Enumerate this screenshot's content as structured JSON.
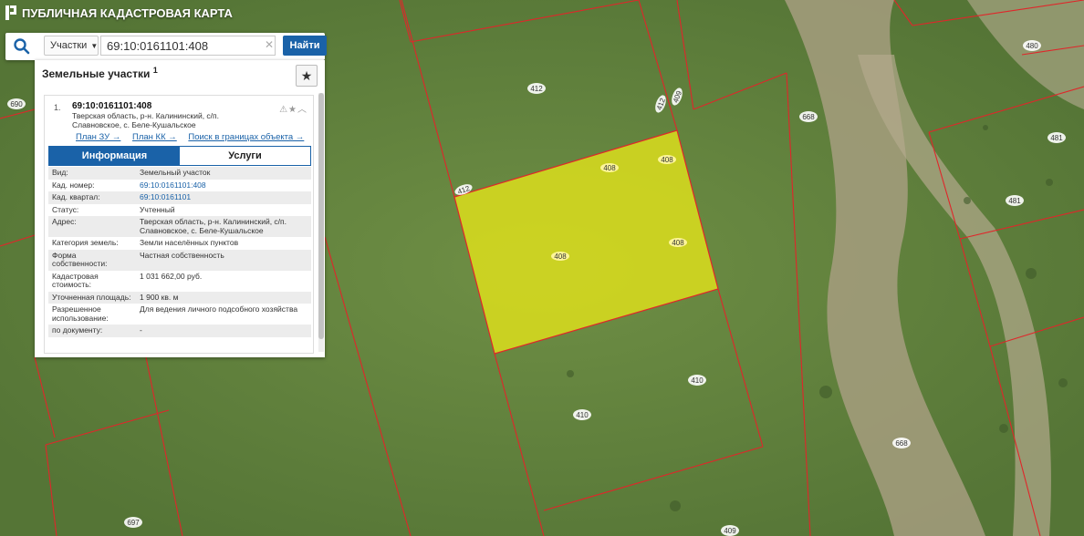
{
  "app": {
    "title": "ПУБЛИЧНАЯ КАДАСТРОВАЯ КАРТА"
  },
  "search": {
    "type_label": "Участки",
    "value": "69:10:0161101:408",
    "button_label": "Найти"
  },
  "panel": {
    "title": "Земельные участки",
    "count": "1",
    "item": {
      "number": "1.",
      "cadastral": "69:10:0161101:408",
      "address_line1": "Тверская область, р-н. Калининский, с/п.",
      "address_line2": "Славновское, с. Беле-Кушальское",
      "links": [
        "План ЗУ →",
        "План КК →",
        "Поиск в границах объекта →"
      ],
      "tabs": [
        "Информация",
        "Услуги"
      ]
    },
    "info": [
      {
        "key": "Вид:",
        "value": "Земельный участок"
      },
      {
        "key": "Кад. номер:",
        "value": "69:10:0161101:408"
      },
      {
        "key": "Кад. квартал:",
        "value": "69:10:0161101"
      },
      {
        "key": "Статус:",
        "value": "Учтенный"
      },
      {
        "key": "Адрес:",
        "value": "Тверская область, р-н. Калининский, с/п. Славновское, с. Беле-Кушальское"
      },
      {
        "key": "Категория земель:",
        "value": "Земли населённых пунктов"
      },
      {
        "key": "Форма собственности:",
        "value": "Частная собственность"
      },
      {
        "key": "Кадастровая стоимость:",
        "value": "1 031 662,00 руб."
      },
      {
        "key": "Уточненная площадь:",
        "value": "1 900 кв. м"
      },
      {
        "key": "Разрешенное использование:",
        "value": "Для ведения личного подсобного хозяйства"
      },
      {
        "key": "по документу:",
        "value": "-"
      }
    ]
  },
  "map": {
    "parcel_labels": [
      "690",
      "412",
      "412",
      "412",
      "668",
      "480",
      "481",
      "481",
      "408",
      "408",
      "408",
      "408",
      "410",
      "410",
      "668",
      "697",
      "409"
    ]
  },
  "colors": {
    "accent": "#1a62a8",
    "boundary": "#e0262a",
    "highlight": "#e6e619"
  }
}
